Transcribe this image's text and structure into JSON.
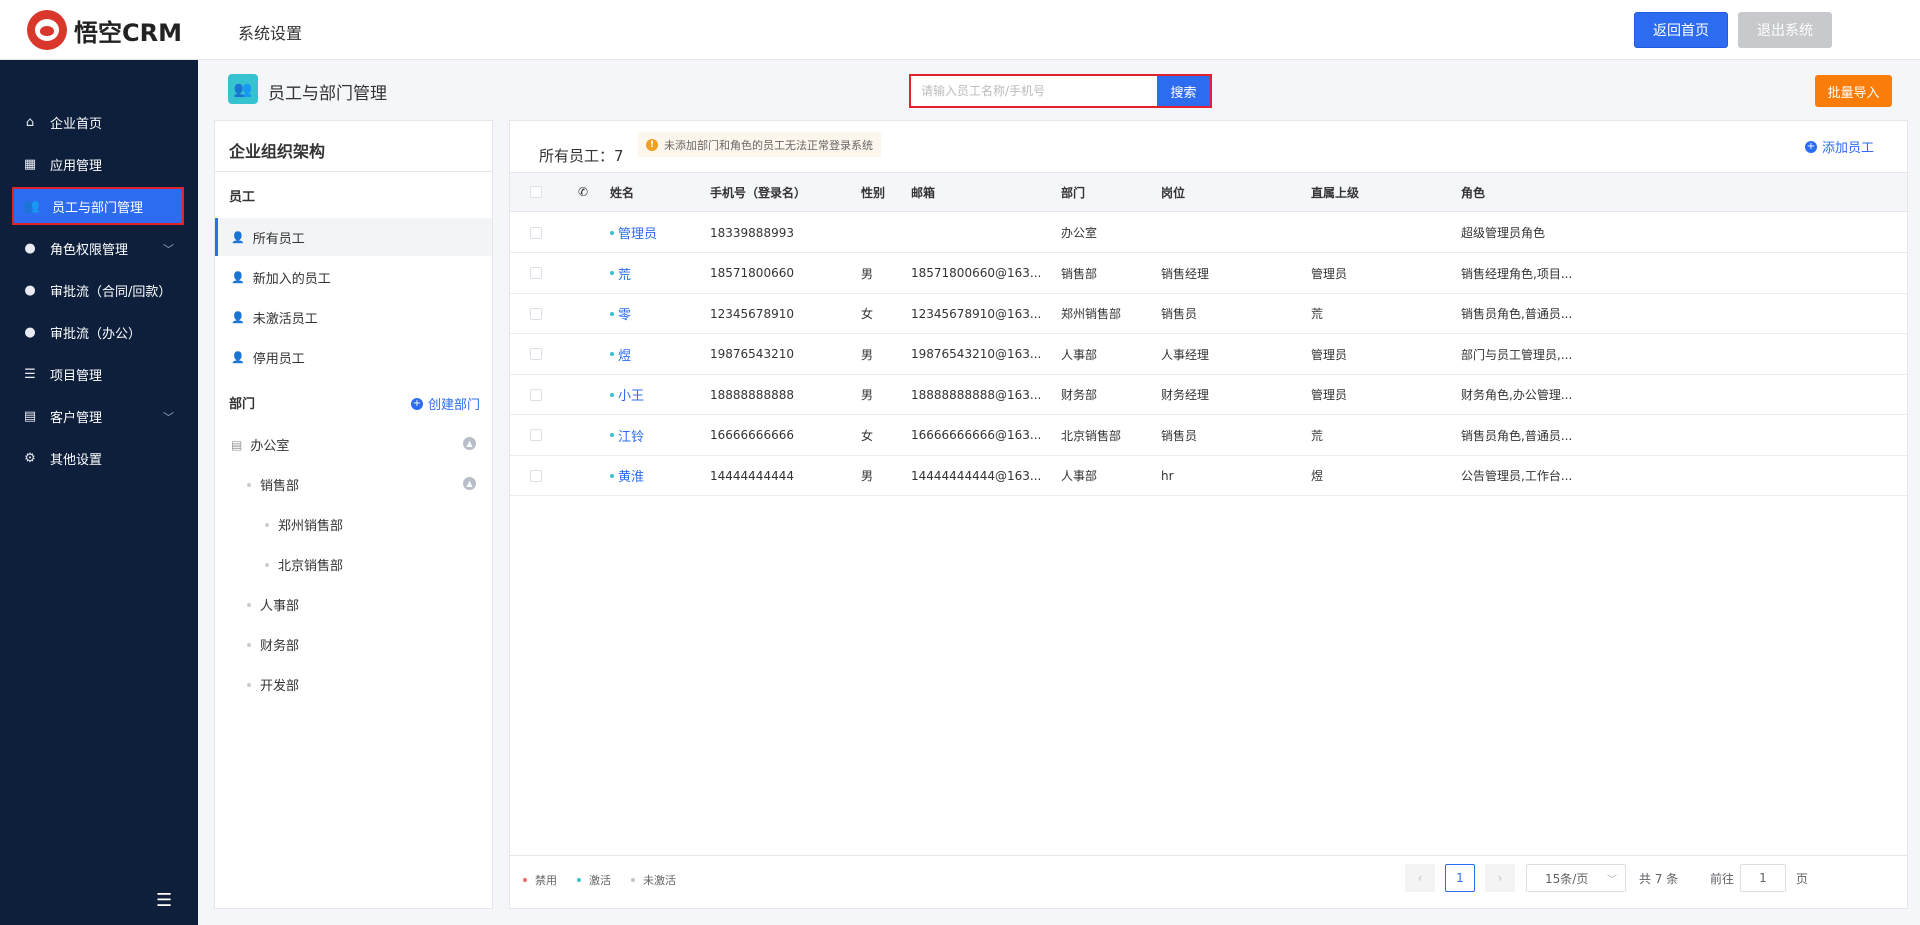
{
  "header": {
    "logo_text": "悟空CRM",
    "section_title": "系统设置",
    "home_button": "返回首页",
    "logout_button": "退出系统"
  },
  "sidebar": {
    "items": [
      {
        "label": "企业首页",
        "icon": "home-icon"
      },
      {
        "label": "应用管理",
        "icon": "grid-icon"
      },
      {
        "label": "员工与部门管理",
        "icon": "users-icon",
        "active": true
      },
      {
        "label": "角色权限管理",
        "icon": "user-icon",
        "has_arrow": true
      },
      {
        "label": "审批流（合同/回款）",
        "icon": "user-icon"
      },
      {
        "label": "审批流（办公）",
        "icon": "user-icon"
      },
      {
        "label": "项目管理",
        "icon": "list-icon"
      },
      {
        "label": "客户管理",
        "icon": "building-icon",
        "has_arrow": true
      },
      {
        "label": "其他设置",
        "icon": "gear-icon"
      }
    ]
  },
  "page": {
    "title": "员工与部门管理",
    "search_placeholder": "请输入员工名称/手机号",
    "search_button": "搜索",
    "bulk_import_button": "批量导入"
  },
  "tree": {
    "title": "企业组织架构",
    "employees_label": "员工",
    "employee_filters": [
      "所有员工",
      "新加入的员工",
      "未激活员工",
      "停用员工"
    ],
    "departments_label": "部门",
    "create_dept": "创建部门",
    "departments": [
      {
        "name": "办公室",
        "level": 0,
        "collapsible": true
      },
      {
        "name": "销售部",
        "level": 1,
        "collapsible": true
      },
      {
        "name": "郑州销售部",
        "level": 2
      },
      {
        "name": "北京销售部",
        "level": 2
      },
      {
        "name": "人事部",
        "level": 1
      },
      {
        "name": "财务部",
        "level": 1
      },
      {
        "name": "开发部",
        "level": 1
      }
    ]
  },
  "table": {
    "count_label": "所有员工：7",
    "notice": "未添加部门和角色的员工无法正常登录系统",
    "add_employee": "添加员工",
    "columns": [
      "姓名",
      "手机号（登录名）",
      "性别",
      "邮箱",
      "部门",
      "岗位",
      "直属上级",
      "角色"
    ],
    "rows": [
      {
        "name": "管理员",
        "phone": "18339888993",
        "gender": "",
        "email": "",
        "dept": "办公室",
        "post": "",
        "leader": "",
        "role": "超级管理员角色"
      },
      {
        "name": "荒",
        "phone": "18571800660",
        "gender": "男",
        "email": "18571800660@163...",
        "dept": "销售部",
        "post": "销售经理",
        "leader": "管理员",
        "role": "销售经理角色,项目..."
      },
      {
        "name": "零",
        "phone": "12345678910",
        "gender": "女",
        "email": "12345678910@163...",
        "dept": "郑州销售部",
        "post": "销售员",
        "leader": "荒",
        "role": "销售员角色,普通员..."
      },
      {
        "name": "煜",
        "phone": "19876543210",
        "gender": "男",
        "email": "19876543210@163...",
        "dept": "人事部",
        "post": "人事经理",
        "leader": "管理员",
        "role": "部门与员工管理员,..."
      },
      {
        "name": "小王",
        "phone": "18888888888",
        "gender": "男",
        "email": "18888888888@163...",
        "dept": "财务部",
        "post": "财务经理",
        "leader": "管理员",
        "role": "财务角色,办公管理..."
      },
      {
        "name": "江铃",
        "phone": "16666666666",
        "gender": "女",
        "email": "16666666666@163...",
        "dept": "北京销售部",
        "post": "销售员",
        "leader": "荒",
        "role": "销售员角色,普通员..."
      },
      {
        "name": "黄淮",
        "phone": "14444444444",
        "gender": "男",
        "email": "14444444444@163...",
        "dept": "人事部",
        "post": "hr",
        "leader": "煜",
        "role": "公告管理员,工作台..."
      }
    ]
  },
  "legend": [
    {
      "label": "禁用",
      "color": "#f56c6c"
    },
    {
      "label": "激活",
      "color": "#36c3d0"
    },
    {
      "label": "未激活",
      "color": "#c0c4cc"
    }
  ],
  "pagination": {
    "current_page": "1",
    "page_size": "15条/页",
    "total": "共 7 条",
    "goto_label": "前往",
    "goto_value": "1",
    "page_suffix": "页"
  },
  "colors": {
    "primary": "#2d6cf0",
    "sidebar_bg": "#0e1f3c",
    "orange": "#fa7d09",
    "highlight_border": "#e0222a"
  }
}
